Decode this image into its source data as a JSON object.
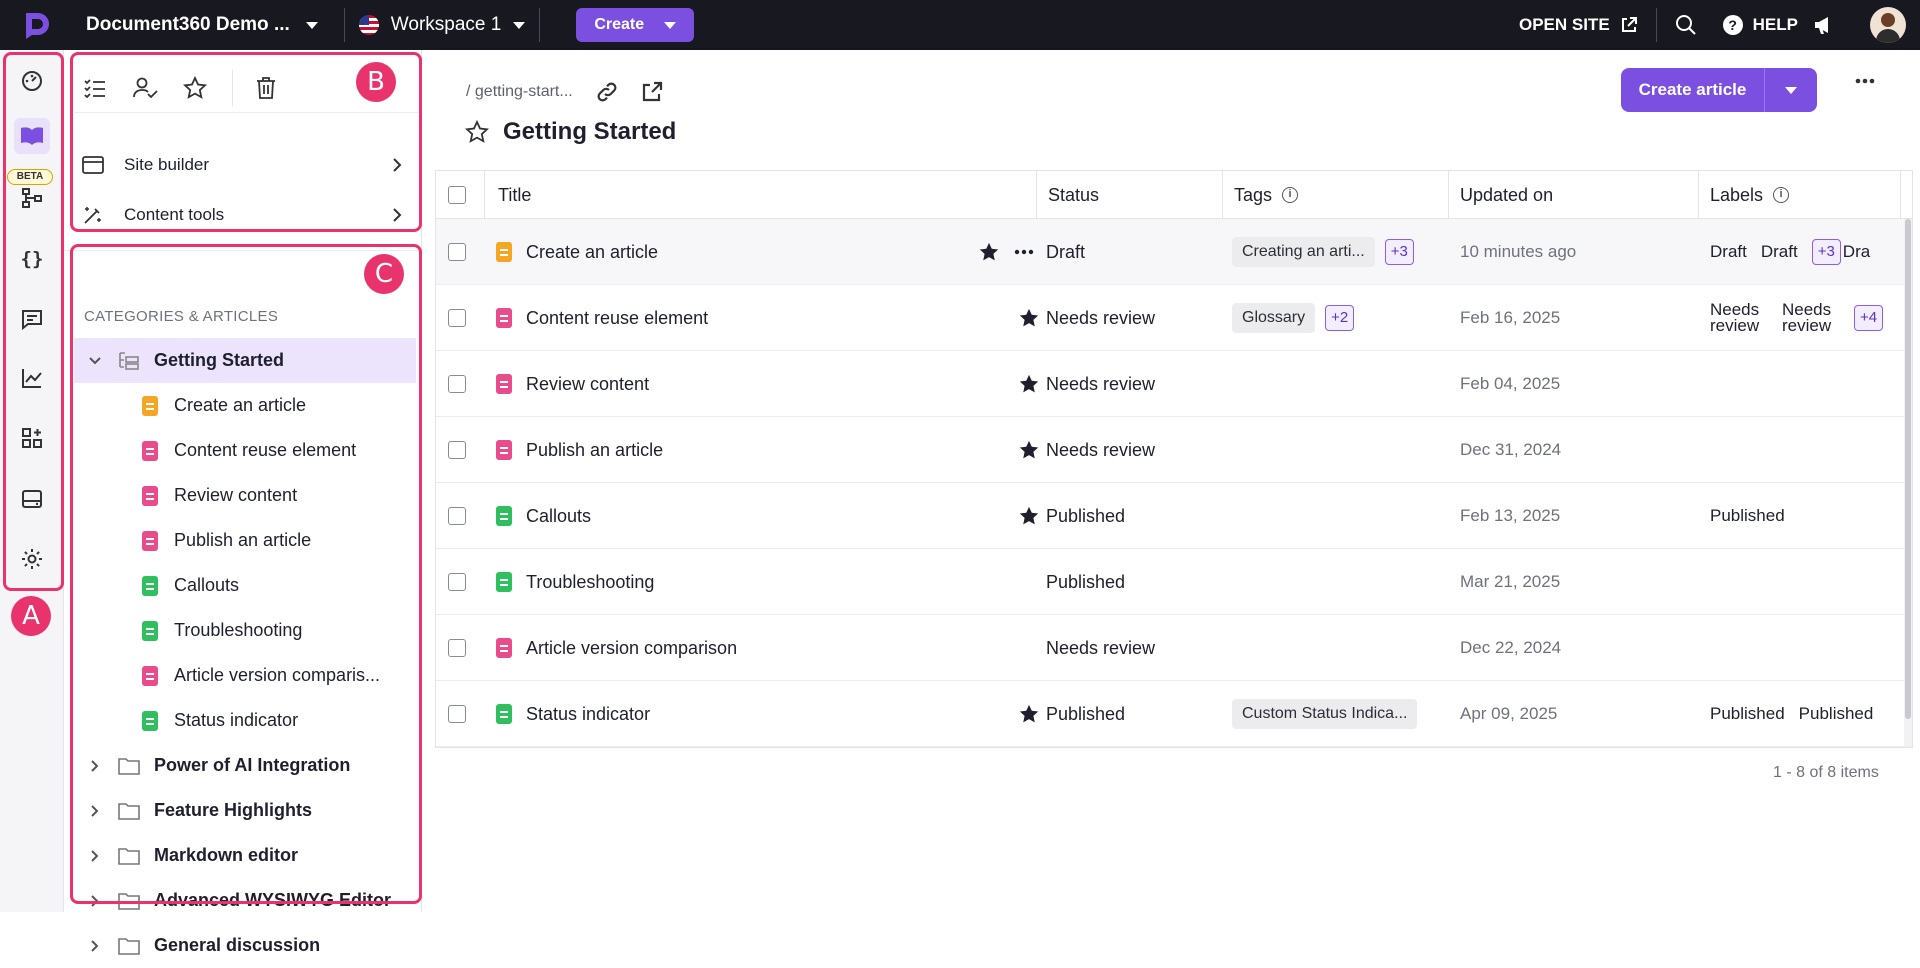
{
  "topbar": {
    "project_name": "Document360 Demo ...",
    "workspace": "Workspace 1",
    "create_label": "Create",
    "open_site": "OPEN SITE",
    "help": "HELP"
  },
  "rail": {
    "beta_label": "BETA",
    "icons": [
      "dashboard-icon",
      "book-icon",
      "flow-icon",
      "code-braces-icon",
      "chat-icon",
      "analytics-icon",
      "integrations-icon",
      "drive-icon",
      "settings-icon"
    ]
  },
  "nav": {
    "menus": [
      {
        "label": "Site builder"
      },
      {
        "label": "Content tools"
      }
    ],
    "categories_heading": "CATEGORIES & ARTICLES",
    "selected_category": "Getting Started",
    "articles": [
      {
        "title": "Create an article",
        "status": "draft"
      },
      {
        "title": "Content reuse element",
        "status": "review"
      },
      {
        "title": "Review content",
        "status": "review"
      },
      {
        "title": "Publish an article",
        "status": "review"
      },
      {
        "title": "Callouts",
        "status": "published"
      },
      {
        "title": "Troubleshooting",
        "status": "published"
      },
      {
        "title": "Article version comparis...",
        "status": "review"
      },
      {
        "title": "Status indicator",
        "status": "published"
      }
    ],
    "other_categories": [
      "Power of AI Integration",
      "Feature Highlights",
      "Markdown editor",
      "Advanced WYSIWYG Editor",
      "General discussion"
    ]
  },
  "main": {
    "breadcrumb": "/ getting-start...",
    "title": "Getting Started",
    "create_article": "Create article",
    "columns": {
      "title": "Title",
      "status": "Status",
      "tags": "Tags",
      "updated": "Updated on",
      "labels": "Labels"
    },
    "rows": [
      {
        "title": "Create an article",
        "doc": "draft",
        "starred": true,
        "status": "Draft",
        "tag": "Creating an arti...",
        "tag_more": "+3",
        "updated": "10 minutes ago",
        "labels": [
          "Draft",
          "Draft"
        ],
        "label_more": "+3",
        "label_cut": "Dra"
      },
      {
        "title": "Content reuse element",
        "doc": "review",
        "starred": true,
        "status": "Needs review",
        "tag": "Glossary",
        "tag_more": "+2",
        "updated": "Feb 16, 2025",
        "labels": [
          "Needs review",
          "Needs review"
        ],
        "label_more": "+4",
        "label_cut": ""
      },
      {
        "title": "Review content",
        "doc": "review",
        "starred": true,
        "status": "Needs review",
        "tag": "",
        "tag_more": "",
        "updated": "Feb 04, 2025",
        "labels": [],
        "label_more": "",
        "label_cut": ""
      },
      {
        "title": "Publish an article",
        "doc": "review",
        "starred": true,
        "status": "Needs review",
        "tag": "",
        "tag_more": "",
        "updated": "Dec 31, 2024",
        "labels": [],
        "label_more": "",
        "label_cut": ""
      },
      {
        "title": "Callouts",
        "doc": "published",
        "starred": true,
        "status": "Published",
        "tag": "",
        "tag_more": "",
        "updated": "Feb 13, 2025",
        "labels": [
          "Published"
        ],
        "label_more": "",
        "label_cut": ""
      },
      {
        "title": "Troubleshooting",
        "doc": "published",
        "starred": false,
        "status": "Published",
        "tag": "",
        "tag_more": "",
        "updated": "Mar 21, 2025",
        "labels": [],
        "label_more": "",
        "label_cut": ""
      },
      {
        "title": "Article version comparison",
        "doc": "review",
        "starred": false,
        "status": "Needs review",
        "tag": "",
        "tag_more": "",
        "updated": "Dec 22, 2024",
        "labels": [],
        "label_more": "",
        "label_cut": ""
      },
      {
        "title": "Status indicator",
        "doc": "published",
        "starred": true,
        "status": "Published",
        "tag": "Custom Status Indica...",
        "tag_more": "",
        "updated": "Apr 09, 2025",
        "labels": [
          "Published",
          "Published"
        ],
        "label_more": "",
        "label_cut": ""
      }
    ],
    "pagination": "1 - 8 of 8 items"
  },
  "callouts": {
    "a": "A",
    "b": "B",
    "c": "C"
  },
  "colors": {
    "accent": "#7b4fe0",
    "highlight": "#e8336d",
    "draft": "#f5a623",
    "review": "#e84c8a",
    "published": "#2fbf5f"
  }
}
